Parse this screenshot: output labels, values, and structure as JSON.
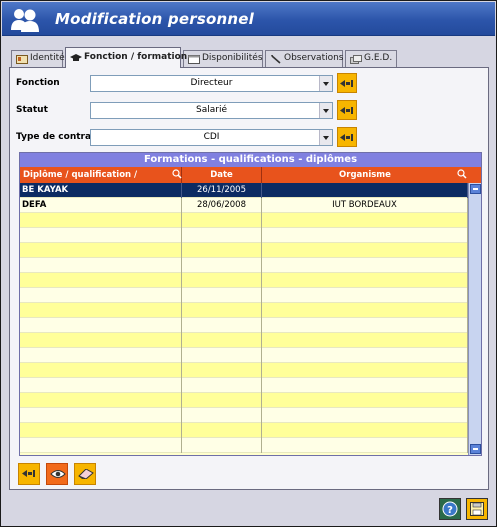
{
  "window": {
    "title": "Modification personnel",
    "accent": "#2c55aa"
  },
  "tabs": [
    {
      "label": "Identité",
      "icon": "id-card-icon",
      "active": false
    },
    {
      "label": "Fonction / formation",
      "icon": "mortarboard-icon",
      "active": true
    },
    {
      "label": "Disponibilités",
      "icon": "calendar-icon",
      "active": false
    },
    {
      "label": "Observations",
      "icon": "pen-icon",
      "active": false
    },
    {
      "label": "G.E.D.",
      "icon": "documents-icon",
      "active": false
    }
  ],
  "form": {
    "fonction": {
      "label": "Fonction",
      "value": "Directeur"
    },
    "statut": {
      "label": "Statut",
      "value": "Salarié"
    },
    "contrat": {
      "label": "Type de contrat",
      "value": "CDI"
    }
  },
  "grid": {
    "caption": "Formations - qualifications - diplômes",
    "columns": [
      "Diplôme / qualification / formation",
      "Date",
      "Organisme"
    ],
    "rows": [
      {
        "diplome": "BE KAYAK",
        "date": "26/11/2005",
        "organisme": "",
        "selected": true
      },
      {
        "diplome": "DEFA",
        "date": "28/06/2008",
        "organisme": "IUT BORDEAUX",
        "selected": false
      }
    ],
    "empty_rows": 16,
    "colors": {
      "caption": "#8080e0",
      "header": "#e8531c",
      "row": "#ffff99",
      "selected": "#0c2b63"
    }
  },
  "toolbar": {
    "items": [
      "link-icon",
      "eye-icon",
      "eraser-icon"
    ]
  },
  "footer": {
    "items": [
      "help-icon",
      "save-icon"
    ]
  }
}
